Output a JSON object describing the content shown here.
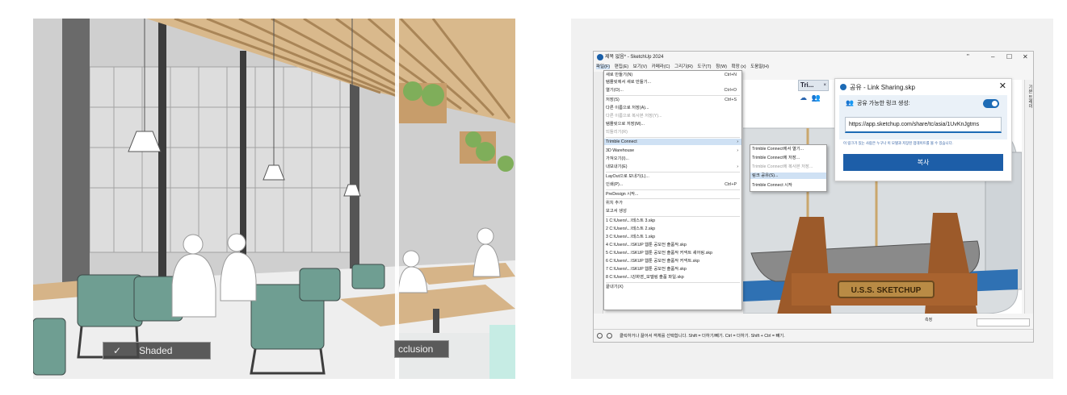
{
  "left_render": {
    "mode_chip_check": "✓",
    "mode_chip_label": "Shaded",
    "right_chip_label": "cclusion"
  },
  "window": {
    "title": "제목 없음* - SketchUp 2024",
    "controls": {
      "restore": "\"",
      "minimize": "–",
      "maximize": "☐",
      "close": "✕"
    },
    "menu": [
      "파일(F)",
      "편집(E)",
      "보기(V)",
      "카메라(C)",
      "그리기(R)",
      "도구(T)",
      "창(W)",
      "확장 (x)",
      "도움말(H)"
    ]
  },
  "file_menu": {
    "items": [
      {
        "label": "새로 만들기(N)",
        "shortcut": "Ctrl+N"
      },
      {
        "label": "템플릿에서 새로 만들기...",
        "shortcut": ""
      },
      {
        "label": "열기(O)...",
        "shortcut": "Ctrl+O"
      },
      {
        "label": "저장(S)",
        "shortcut": "Ctrl+S"
      },
      {
        "label": "다른 이름으로 저장(A)...",
        "shortcut": ""
      },
      {
        "label": "다른 이름으로 복사본 저장(Y)...",
        "shortcut": ""
      },
      {
        "label": "템플릿으로 저장(M)...",
        "shortcut": ""
      },
      {
        "label": "되돌리기(R)",
        "shortcut": ""
      },
      {
        "label": "Trimble Connect",
        "shortcut": ""
      },
      {
        "label": "3D Warehouse",
        "shortcut": ""
      },
      {
        "label": "가져오기(I)...",
        "shortcut": ""
      },
      {
        "label": "내보내기(E)",
        "shortcut": ""
      },
      {
        "label": "LayOut으로 보내기(L)...",
        "shortcut": ""
      },
      {
        "label": "인쇄(P)...",
        "shortcut": "Ctrl+P"
      },
      {
        "label": "PreDesign 시작...",
        "shortcut": ""
      },
      {
        "label": "위치 추가",
        "shortcut": ""
      },
      {
        "label": "보고서 생성",
        "shortcut": ""
      },
      {
        "label": "1 C:\\Users\\...\\테스트 3.skp",
        "shortcut": ""
      },
      {
        "label": "2 C:\\Users\\...\\테스트 2.skp",
        "shortcut": ""
      },
      {
        "label": "3 C:\\Users\\...\\테스트 1.skp",
        "shortcut": ""
      },
      {
        "label": "4 C:\\Users\\...\\SKUP 웹툰 공모전 출품작.skp",
        "shortcut": ""
      },
      {
        "label": "5 C:\\Users\\...\\SKUP 웹툰 공모전 출품작 커넥트 셰어링.skp",
        "shortcut": ""
      },
      {
        "label": "6 C:\\Users\\...\\SKUP 웹툰 공모전 출품작 커넥트.skp",
        "shortcut": ""
      },
      {
        "label": "7 C:\\Users\\...\\SKUP 웹툰 공모전 출품작.skp",
        "shortcut": ""
      },
      {
        "label": "8 C:\\Users\\...\\강화영_모델링 출품 파일.skp",
        "shortcut": ""
      },
      {
        "label": "끝내기(X)",
        "shortcut": ""
      }
    ]
  },
  "submenu": {
    "items": [
      "Trimble Connect에서 열기...",
      "Trimble Connect에 저장...",
      "Trimble Connect에 복사본 저장...",
      "링크 공유(S)...",
      "Trimble Connect 시작"
    ]
  },
  "trimble_tab": {
    "label": "Tri...",
    "close": "×"
  },
  "tray_label": "기본 트레이",
  "share_dialog": {
    "title": "공유 - Link Sharing.skp",
    "close": "✕",
    "toggle_label": "공유 가능한 링크 생성:",
    "toggle_on": true,
    "url": "https://app.sketchup.com/share/tc/asia/1UvKnJgtms",
    "note": "이 링크가 있는 사람은 누구나 이 모델과 저장된 업데이트를 볼 수 있습니다.",
    "copy_button": "복사"
  },
  "model": {
    "plaque_text": "U.S.S. SKETCHUP"
  },
  "statusbar": {
    "hint": "클릭하거나 끌어서 객체를 선택합니다. Shift = 더하기/빼기. Ctrl = 더하기. Shift + Ctrl = 빼기.",
    "measure_label": "측정"
  },
  "colors": {
    "accent": "#1d5ea8",
    "chair_green": "#6f9e92",
    "wood": "#c9a277"
  }
}
